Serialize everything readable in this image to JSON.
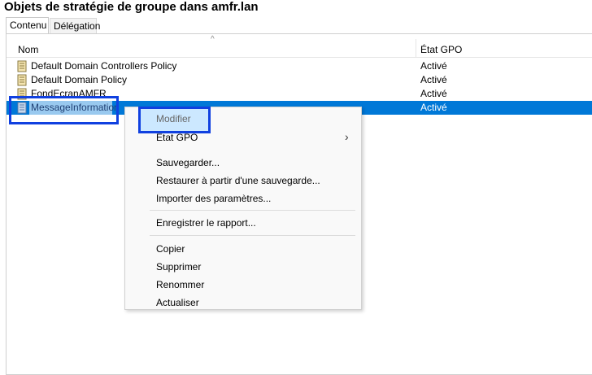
{
  "window": {
    "title": "Objets de stratégie de groupe dans amfr.lan"
  },
  "tabs": [
    {
      "label": "Contenu"
    },
    {
      "label": "Délégation"
    }
  ],
  "table": {
    "columns": [
      "Nom",
      "État GPO"
    ],
    "rows": [
      {
        "name": "Default Domain Controllers Policy",
        "state": "Activé"
      },
      {
        "name": "Default Domain Policy",
        "state": "Activé"
      },
      {
        "name": "FondEcranAMFR",
        "state": "Activé"
      },
      {
        "name": "MessageInformation",
        "state": "Activé"
      }
    ]
  },
  "context_menu": {
    "items": [
      {
        "label": "Modifier"
      },
      {
        "label": "État GPO",
        "submenu": true
      },
      {
        "label": "Sauvegarder..."
      },
      {
        "label": "Restaurer à partir d'une sauvegarde..."
      },
      {
        "label": "Importer des paramètres..."
      },
      {
        "label": "Enregistrer le rapport..."
      },
      {
        "label": "Copier"
      },
      {
        "label": "Supprimer"
      },
      {
        "label": "Renommer"
      },
      {
        "label": "Actualiser"
      }
    ]
  },
  "colors": {
    "selection": "#0078d7",
    "highlight_frame": "#1040e0"
  }
}
